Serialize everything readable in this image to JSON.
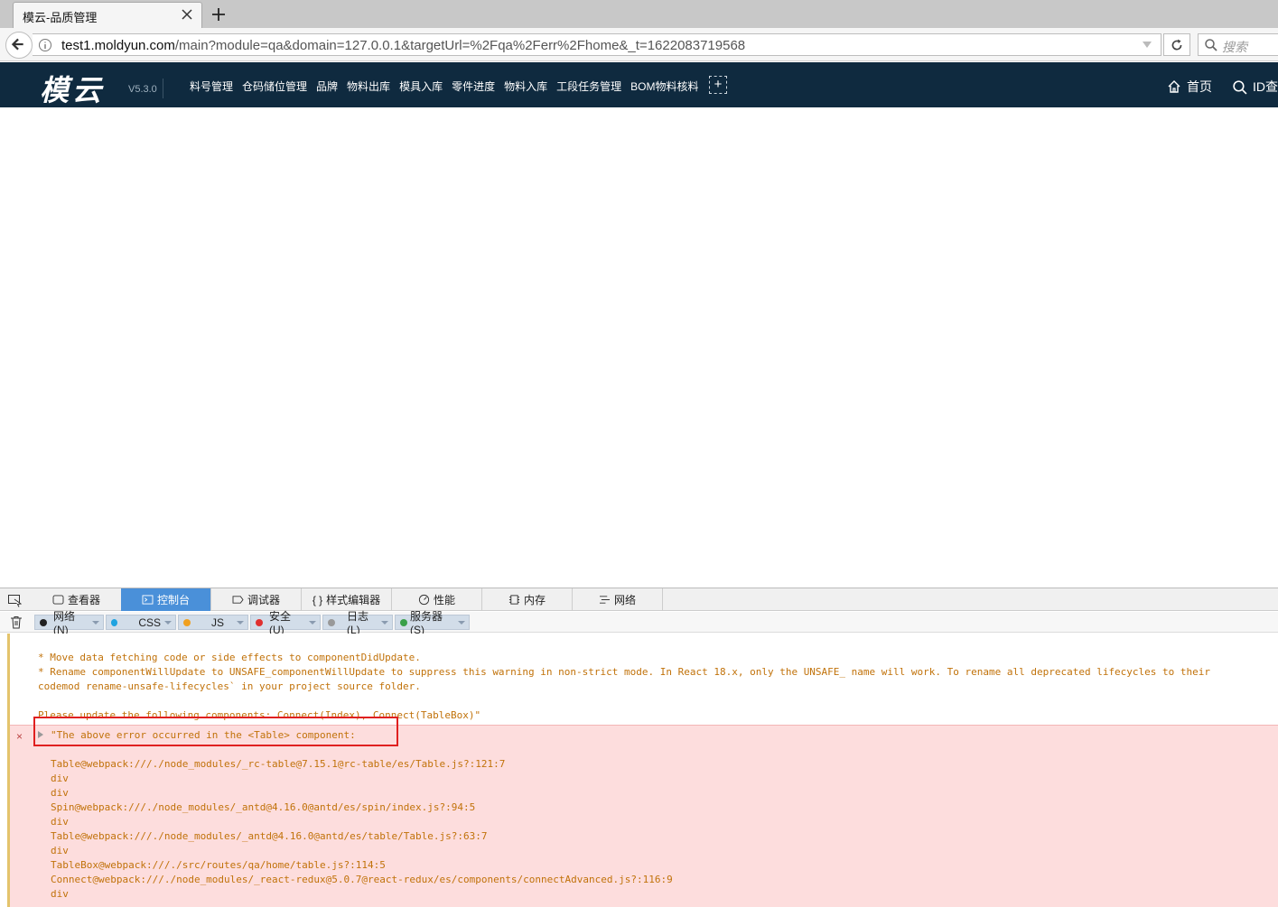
{
  "browser": {
    "tab_title": "模云-品质管理",
    "url_host": "test1.moldyun.com",
    "url_rest": "/main?module=qa&domain=127.0.0.1&targetUrl=%2Fqa%2Ferr%2Fhome&_t=1622083719568",
    "search_placeholder": "搜索"
  },
  "app": {
    "logo": "模云",
    "version": "V5.3.0",
    "menu": [
      "料号管理",
      "仓码储位管理",
      "品牌",
      "物料出库",
      "模具入库",
      "零件进度",
      "物料入库",
      "工段任务管理",
      "BOM物料核料"
    ],
    "add_label": "+",
    "home_label": "首页",
    "id_label": "ID查"
  },
  "devtools": {
    "tabs": [
      {
        "label": "查看器",
        "icon": "inspector-icon"
      },
      {
        "label": "控制台",
        "icon": "console-icon"
      },
      {
        "label": "调试器",
        "icon": "debugger-icon"
      },
      {
        "label": "样式编辑器",
        "icon": "style-editor-icon"
      },
      {
        "label": "性能",
        "icon": "performance-icon"
      },
      {
        "label": "内存",
        "icon": "memory-icon"
      },
      {
        "label": "网络",
        "icon": "network-icon"
      }
    ],
    "filters": [
      {
        "label": "网络(N)",
        "color": "#222222"
      },
      {
        "label": "CSS",
        "color": "#1fa3e0"
      },
      {
        "label": "JS",
        "color": "#f0a020"
      },
      {
        "label": "安全(U)",
        "color": "#e0302f"
      },
      {
        "label": "日志(L)",
        "color": "#999999"
      },
      {
        "label": "服务器(S)",
        "color": "#3aa04a"
      }
    ],
    "warning_lines": [
      "* Move data fetching code or side effects to componentDidUpdate.",
      "* Rename componentWillUpdate to UNSAFE_componentWillUpdate to suppress this warning in non-strict mode. In React 18.x, only the UNSAFE_ name will work. To rename all deprecated lifecycles to their",
      "codemod rename-unsafe-lifecycles` in your project source folder.",
      "",
      "Please update the following components: Connect(Index), Connect(TableBox)\""
    ],
    "error_header": "\"The above error occurred in the <Table> component:",
    "error_lines": [
      "",
      "Table@webpack:///./node_modules/_rc-table@7.15.1@rc-table/es/Table.js?:121:7",
      "div",
      "div",
      "Spin@webpack:///./node_modules/_antd@4.16.0@antd/es/spin/index.js?:94:5",
      "div",
      "Table@webpack:///./node_modules/_antd@4.16.0@antd/es/table/Table.js?:63:7",
      "div",
      "TableBox@webpack:///./src/routes/qa/home/table.js?:114:5",
      "Connect@webpack:///./node_modules/_react-redux@5.0.7@react-redux/es/components/connectAdvanced.js?:116:9",
      "div"
    ],
    "error_icon": "×"
  }
}
